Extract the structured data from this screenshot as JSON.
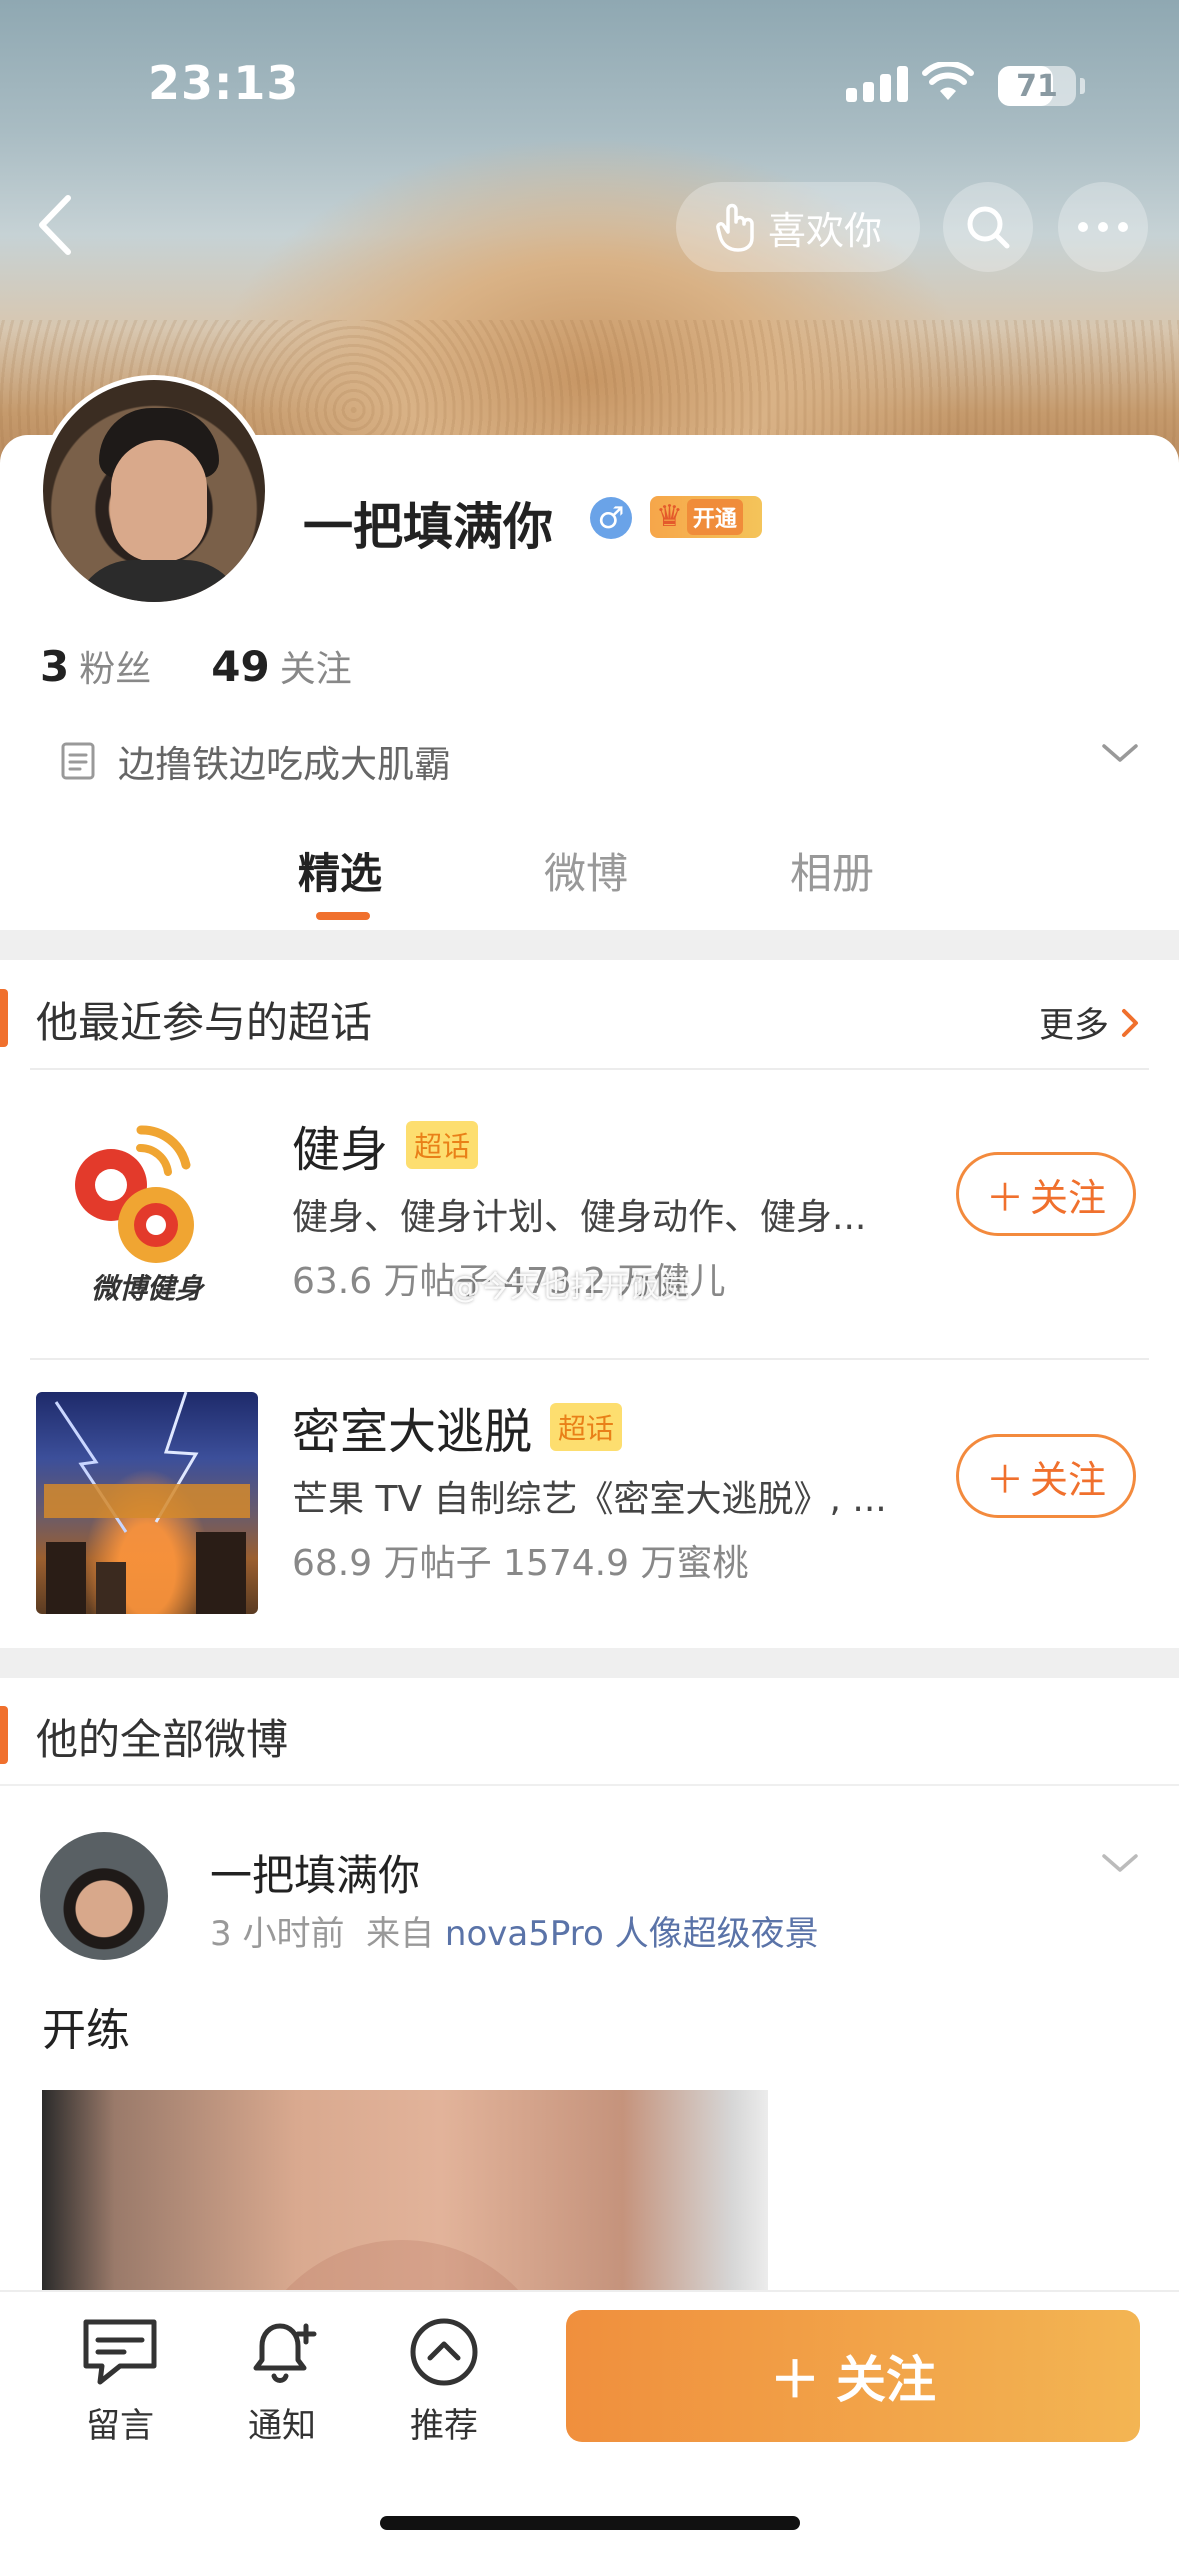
{
  "status_bar": {
    "time": "23:13",
    "battery": "71",
    "battery_level": 0.71
  },
  "header": {
    "like_label": "喜欢你"
  },
  "profile": {
    "name": "一把填满你",
    "gender_symbol": "♂",
    "vip_label": "开通",
    "followers_count": "3",
    "followers_label": "粉丝",
    "following_count": "49",
    "following_label": "关注",
    "bio": "边撸铁边吃成大肌霸"
  },
  "tabs": [
    {
      "label": "精选",
      "active": true
    },
    {
      "label": "微博",
      "active": false
    },
    {
      "label": "相册",
      "active": false
    }
  ],
  "topics_section": {
    "title": "他最近参与的超话",
    "more_label": "更多",
    "items": [
      {
        "name": "健身",
        "badge": "超话",
        "logo_text": "微博健身",
        "description": "健身、健身计划、健身动作、健身...",
        "meta": "63.6 万帖子  473.2 万健儿",
        "follow_label": "关注"
      },
      {
        "name": "密室大逃脱",
        "badge": "超话",
        "description": "芒果 TV 自制综艺《密室大逃脱》, ...",
        "meta": "68.9 万帖子  1574.9 万蜜桃",
        "follow_label": "关注"
      }
    ]
  },
  "watermark": "@今天也打开饭觉",
  "posts_section": {
    "title": "他的全部微博"
  },
  "post": {
    "author": "一把填满你",
    "time": "3 小时前",
    "from_label": "来自",
    "source": "nova5Pro 人像超级夜景",
    "text": "开练"
  },
  "bottom_bar": {
    "message_label": "留言",
    "notify_label": "通知",
    "recommend_label": "推荐",
    "follow_label": "关注"
  },
  "colors": {
    "accent": "#f0702d",
    "badge_bg": "#fdde6f",
    "male_blue": "#6aa3e8"
  }
}
